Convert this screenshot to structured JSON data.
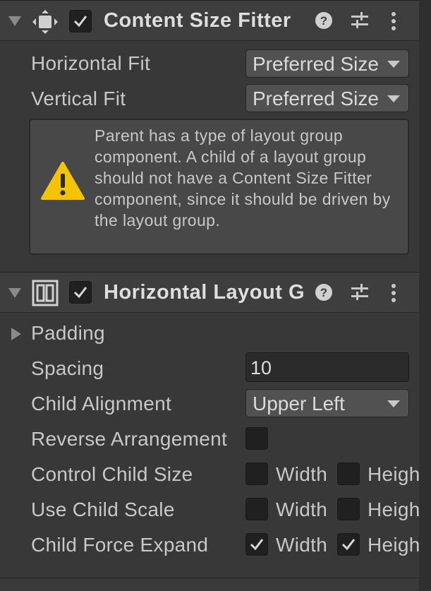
{
  "content_size_fitter": {
    "title": "Content Size Fitter",
    "enabled": true,
    "header_icon": "content-size-fitter-icon",
    "fields": [
      {
        "label": "Horizontal Fit",
        "value": "Preferred Size"
      },
      {
        "label": "Vertical Fit",
        "value": "Preferred Size"
      }
    ],
    "warning": "Parent has a type of layout group component. A child of a layout group should not have a Content Size Fitter component, since it should be driven by the layout group."
  },
  "horizontal_layout_group": {
    "title": "Horizontal Layout Group",
    "enabled": true,
    "header_icon": "horizontal-layout-group-icon",
    "padding_label": "Padding",
    "spacing_label": "Spacing",
    "spacing_value": "10",
    "child_alignment_label": "Child Alignment",
    "child_alignment_value": "Upper Left",
    "reverse_label": "Reverse Arrangement",
    "reverse_checked": false,
    "toggle_rows": [
      {
        "label": "Control Child Size",
        "width_label": "Width",
        "height_label": "Height",
        "width_checked": false,
        "height_checked": false
      },
      {
        "label": "Use Child Scale",
        "width_label": "Width",
        "height_label": "Height",
        "width_checked": false,
        "height_checked": false
      },
      {
        "label": "Child Force Expand",
        "width_label": "Width",
        "height_label": "Height",
        "width_checked": true,
        "height_checked": true
      }
    ]
  },
  "colors": {
    "panel_bg": "#383838",
    "header_bg": "#3e3e3e",
    "dropdown_bg": "#515151",
    "field_bg": "#2a2a2a",
    "warning_yellow": "#f5c400",
    "text": "#c8c8c8"
  },
  "icons": [
    "fold-arrow-icon",
    "checkmark-icon",
    "help-icon",
    "presets-icon",
    "kebab-menu-icon",
    "warning-icon"
  ]
}
